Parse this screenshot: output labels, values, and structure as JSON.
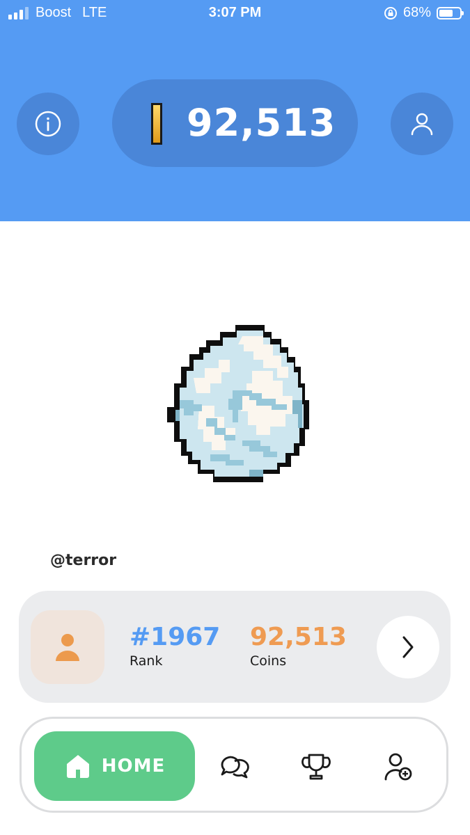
{
  "status_bar": {
    "carrier": "Boost",
    "network": "LTE",
    "time": "3:07 PM",
    "battery": "68%",
    "battery_level": 0.68
  },
  "header": {
    "info_icon": "info-icon",
    "profile_icon": "user-icon",
    "coin_balance": "92,513"
  },
  "pet": {
    "image": "pixel-egg"
  },
  "username": "@terror",
  "stats": {
    "rank_value": "#1967",
    "rank_label": "Rank",
    "coins_value": "92,513",
    "coins_label": "Coins"
  },
  "nav": {
    "home_label": "HOME",
    "items": [
      "home-icon",
      "chat-icon",
      "trophy-icon",
      "add-friend-icon"
    ]
  },
  "colors": {
    "header_bg": "#559bf3",
    "pill_bg": "#4a86d8",
    "rank_blue": "#559bf3",
    "coins_orange": "#ef9b52",
    "home_green": "#5ecb8a"
  }
}
